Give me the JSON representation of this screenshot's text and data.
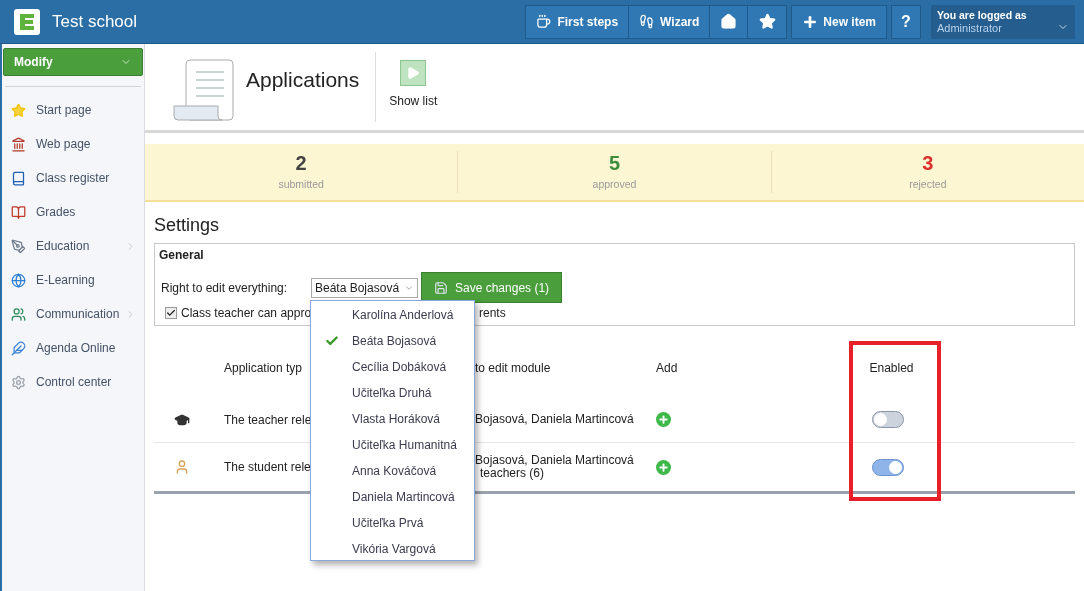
{
  "app": {
    "title": "Test school"
  },
  "toolbar": {
    "buttons": [
      {
        "label": "First steps"
      },
      {
        "label": "Wizard"
      }
    ],
    "new_item": "New item",
    "help": "?"
  },
  "user": {
    "caption": "You are logged as",
    "name": "Administrator"
  },
  "sidebar": {
    "modify": "Modify",
    "items": [
      {
        "label": "Start page",
        "has_submenu": false
      },
      {
        "label": "Web page",
        "has_submenu": false
      },
      {
        "label": "Class register",
        "has_submenu": false
      },
      {
        "label": "Grades",
        "has_submenu": false
      },
      {
        "label": "Education",
        "has_submenu": true
      },
      {
        "label": "E-Learning",
        "has_submenu": false
      },
      {
        "label": "Communication",
        "has_submenu": true
      },
      {
        "label": "Agenda Online",
        "has_submenu": false
      },
      {
        "label": "Control center",
        "has_submenu": false
      }
    ]
  },
  "page": {
    "title": "Applications",
    "actions": [
      "Show list"
    ]
  },
  "stats": [
    {
      "value": "2",
      "label": "submitted",
      "kind": "neutral"
    },
    {
      "value": "5",
      "label": "approved",
      "kind": "positive"
    },
    {
      "value": "3",
      "label": "rejected",
      "kind": "negative"
    }
  ],
  "settings": {
    "title": "Settings",
    "general": {
      "title": "General",
      "right_label": "Right to edit everything:",
      "select_value": "Beáta Bojasová",
      "save_button": "Save changes (1)",
      "checkbox": {
        "label": "Class teacher can appro",
        "label_tail": "rents",
        "checked": true
      }
    }
  },
  "dropdown": {
    "options": [
      {
        "label": "Karolína Anderlová",
        "selected": false
      },
      {
        "label": "Beáta Bojasová",
        "selected": true
      },
      {
        "label": "Cecília Dobáková",
        "selected": false
      },
      {
        "label": "Učiteľka Druhá",
        "selected": false
      },
      {
        "label": "Vlasta Horáková",
        "selected": false
      },
      {
        "label": "Učiteľka Humanitná",
        "selected": false
      },
      {
        "label": "Anna Kováčová",
        "selected": false
      },
      {
        "label": "Daniela Martincová",
        "selected": false
      },
      {
        "label": "Učiteľka Prvá",
        "selected": false
      },
      {
        "label": "Vikória Vargová",
        "selected": false
      }
    ]
  },
  "table": {
    "columns": [
      {
        "label": "Application typ",
        "highlighted": false
      },
      {
        "label": "to edit module",
        "highlighted": false
      },
      {
        "label": "Add",
        "highlighted": false
      },
      {
        "label": "Enabled",
        "highlighted": true
      }
    ],
    "rows": [
      {
        "kind": "teacher",
        "type": "The teacher rele",
        "rights": [
          "Bojasová, Daniela Martincová"
        ],
        "enabled": false
      },
      {
        "kind": "student",
        "type": "The student rele",
        "rights": [
          "Bojasová, Daniela Martincová",
          "teachers (6)"
        ],
        "enabled": true
      }
    ]
  }
}
